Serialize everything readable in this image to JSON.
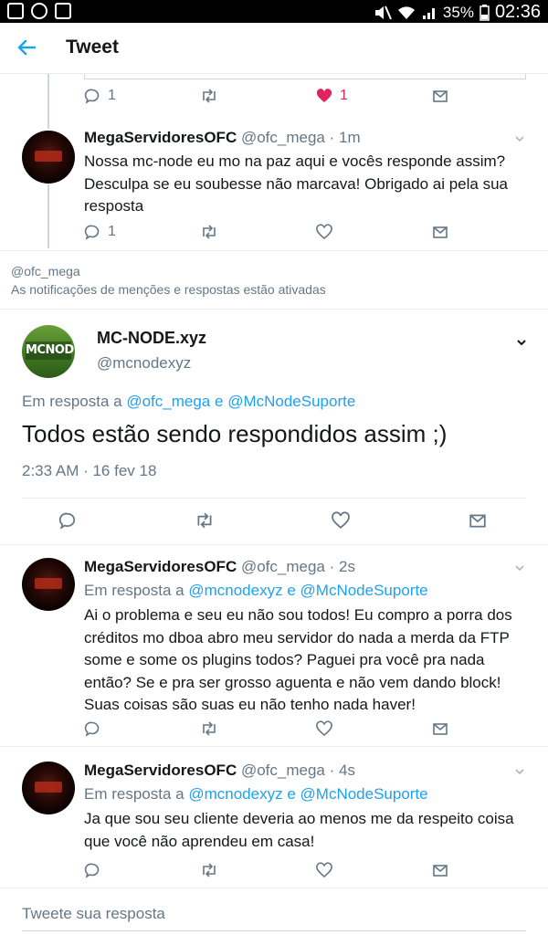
{
  "status_bar": {
    "battery": "35%",
    "time": "02:36"
  },
  "app_bar": {
    "title": "Tweet"
  },
  "context_tweet": {
    "reply_count": "1",
    "like_count": "1"
  },
  "tweets_above": [
    {
      "name": "MegaServidoresOFC",
      "handle": "@ofc_mega",
      "time": "· 1m",
      "text": "Nossa mc-node eu mo na paz aqui e vocês responde assim? Desculpa se eu soubesse não marcava! Obrigado ai pela sua resposta",
      "reply_count": "1"
    }
  ],
  "notice": {
    "handle": "@ofc_mega",
    "text": "As notificações de menções e respostas estão ativadas"
  },
  "main_tweet": {
    "name": "MC-NODE.xyz",
    "handle": "@mcnodexyz",
    "avatar_text": "MCNODE",
    "reply_prefix": "Em resposta a",
    "reply_user1": "@ofc_mega",
    "reply_and": "e",
    "reply_user2": "@McNodeSuporte",
    "text": "Todos estão sendo respondidos assim ;)",
    "timestamp": "2:33 AM · 16 fev 18"
  },
  "replies": [
    {
      "name": "MegaServidoresOFC",
      "handle": "@ofc_mega",
      "time": "· 2s",
      "reply_prefix": "Em resposta a",
      "reply_user1": "@mcnodexyz",
      "reply_and": "e",
      "reply_user2": "@McNodeSuporte",
      "text": "Ai o problema e seu eu não sou todos! Eu compro a porra dos créditos mo dboa abro meu servidor do nada a merda da FTP some e some os plugins todos? Paguei pra você pra nada então? Se e pra ser grosso aguenta e não vem dando block! Suas coisas são suas eu não tenho nada haver!"
    },
    {
      "name": "MegaServidoresOFC",
      "handle": "@ofc_mega",
      "time": "· 4s",
      "reply_prefix": "Em resposta a",
      "reply_user1": "@mcnodexyz",
      "reply_and": "e",
      "reply_user2": "@McNodeSuporte",
      "text": "Ja que sou seu cliente deveria ao menos me da respeito coisa que você não aprendeu em casa!"
    }
  ],
  "composer": {
    "placeholder": "Tweete sua resposta"
  },
  "colors": {
    "accent": "#1da1f2",
    "like": "#e0245e",
    "muted": "#657786"
  }
}
